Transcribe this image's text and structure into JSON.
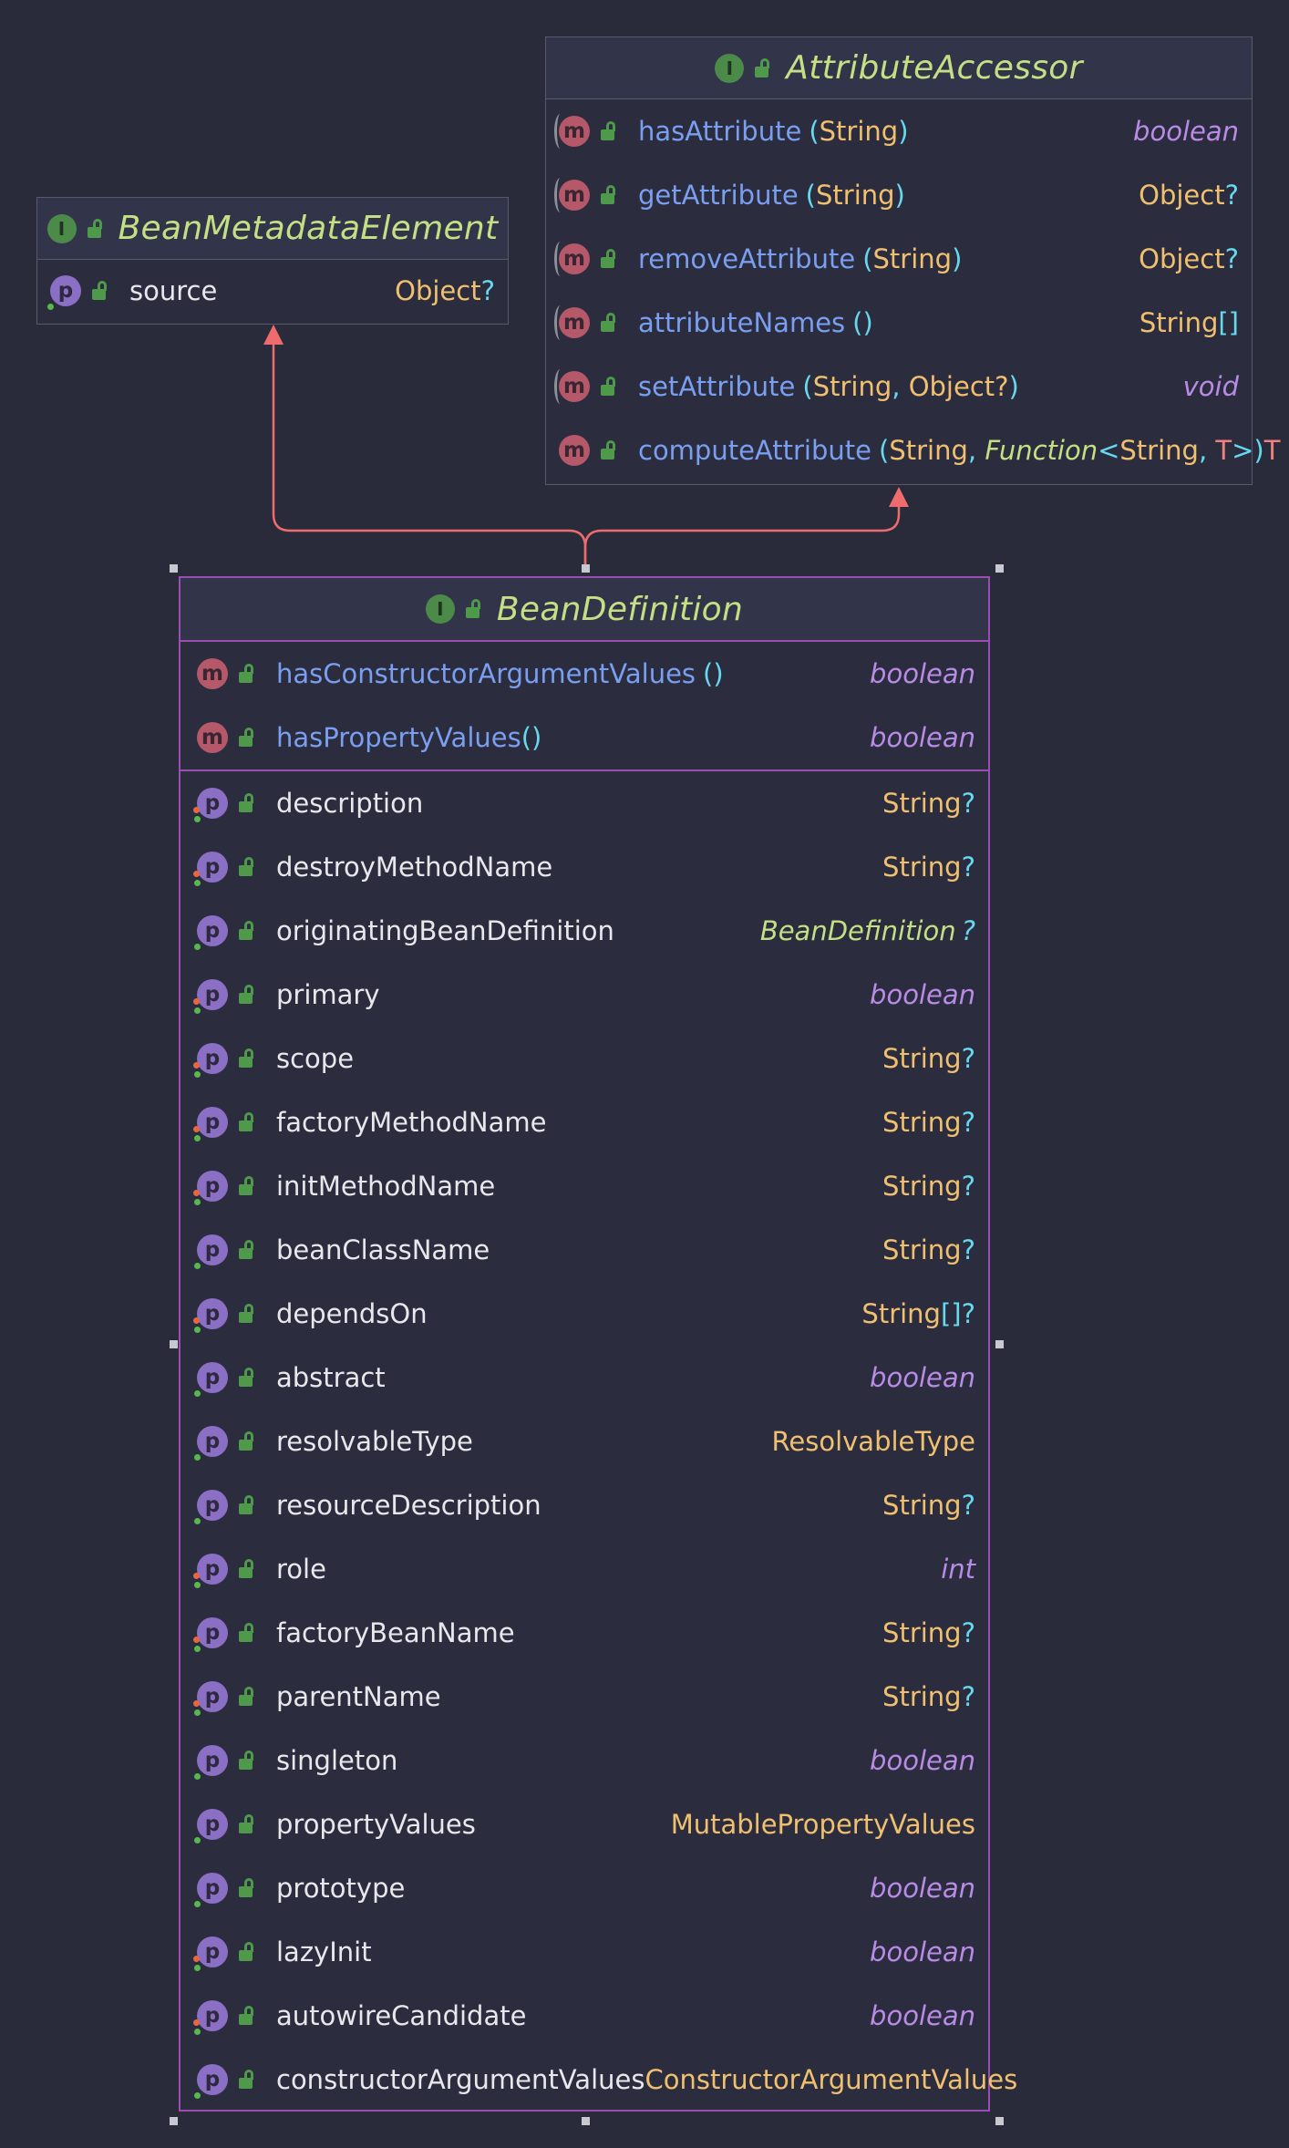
{
  "colors": {
    "background": "#292b3b",
    "edge": "#ee6b6e",
    "selection": "#9a4eb2",
    "title": "#c4df84"
  },
  "icons": {
    "interface": "interface-icon",
    "method": "method-icon",
    "property": "property-icon",
    "access": "public-lock-icon"
  },
  "attribute_accessor": {
    "badge": "I",
    "title": "AttributeAccessor",
    "methods": [
      {
        "name": "hasAttribute",
        "params": [
          "String"
        ],
        "type": "boolean"
      },
      {
        "name": "getAttribute",
        "params": [
          "String"
        ],
        "type": "Object",
        "nullable": "?"
      },
      {
        "name": "removeAttribute",
        "params": [
          "String"
        ],
        "type": "Object",
        "nullable": "?"
      },
      {
        "name": "attributeNames",
        "params": [],
        "type": "String",
        "nullable": "[]"
      },
      {
        "name": "setAttribute",
        "params": [
          "String",
          "Object?"
        ],
        "type": "void"
      },
      {
        "name": "computeAttribute",
        "params_text": {
          "p1": "String",
          "fn": "Function",
          "p2": "String",
          "tv": "T"
        },
        "type": "T"
      }
    ]
  },
  "bean_metadata_element": {
    "badge": "I",
    "title": "BeanMetadataElement",
    "properties": [
      {
        "name": "source",
        "type": "Object",
        "nullable": "?"
      }
    ]
  },
  "bean_definition": {
    "badge": "I",
    "title": "BeanDefinition",
    "methods": [
      {
        "name": "hasConstructorArgumentValues",
        "type": "boolean"
      },
      {
        "name": "hasPropertyValues",
        "type": "boolean"
      }
    ],
    "properties": [
      {
        "name": "description",
        "type": "String",
        "nullable": "?"
      },
      {
        "name": "destroyMethodName",
        "type": "String",
        "nullable": "?"
      },
      {
        "name": "originatingBeanDefinition",
        "type": "BeanDefinition",
        "nullable": "?"
      },
      {
        "name": "primary",
        "type": "boolean"
      },
      {
        "name": "scope",
        "type": "String",
        "nullable": "?"
      },
      {
        "name": "factoryMethodName",
        "type": "String",
        "nullable": "?"
      },
      {
        "name": "initMethodName",
        "type": "String",
        "nullable": "?"
      },
      {
        "name": "beanClassName",
        "type": "String",
        "nullable": "?"
      },
      {
        "name": "dependsOn",
        "type": "String",
        "nullable": "[]?"
      },
      {
        "name": "abstract",
        "type": "boolean"
      },
      {
        "name": "resolvableType",
        "type": "ResolvableType"
      },
      {
        "name": "resourceDescription",
        "type": "String",
        "nullable": "?"
      },
      {
        "name": "role",
        "type": "int"
      },
      {
        "name": "factoryBeanName",
        "type": "String",
        "nullable": "?"
      },
      {
        "name": "parentName",
        "type": "String",
        "nullable": "?"
      },
      {
        "name": "singleton",
        "type": "boolean"
      },
      {
        "name": "propertyValues",
        "type": "MutablePropertyValues"
      },
      {
        "name": "prototype",
        "type": "boolean"
      },
      {
        "name": "lazyInit",
        "type": "boolean"
      },
      {
        "name": "autowireCandidate",
        "type": "boolean"
      },
      {
        "name": "constructorArgumentValues",
        "type": "ConstructorArgumentValues"
      }
    ]
  }
}
